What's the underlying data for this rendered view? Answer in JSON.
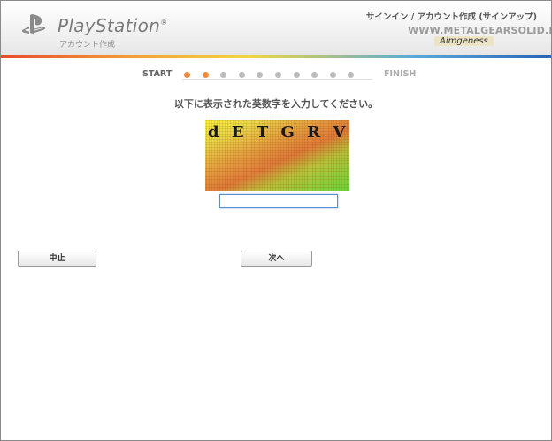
{
  "header": {
    "brand": "PlayStation",
    "brand_reg": "®",
    "subtitle": "アカウント作成",
    "breadcrumb": "サインイン / アカウント作成 (サインアップ)",
    "watermark_url": "WWW.METALGEARSOLID.BE",
    "watermark_tag": "Aimgeness"
  },
  "progress": {
    "start_label": "START",
    "finish_label": "FINISH",
    "steps_total": 10,
    "active_steps": 2
  },
  "form": {
    "instruction": "以下に表示された英数字を入力してください。",
    "captcha_text": "d E T G R V",
    "input_value": "",
    "input_placeholder": ""
  },
  "buttons": {
    "cancel": "中止",
    "next": "次へ"
  },
  "colors": {
    "active_step": "#f08a3e",
    "inactive_step": "#bcbcbc",
    "focus_border": "#5b8fd0"
  }
}
